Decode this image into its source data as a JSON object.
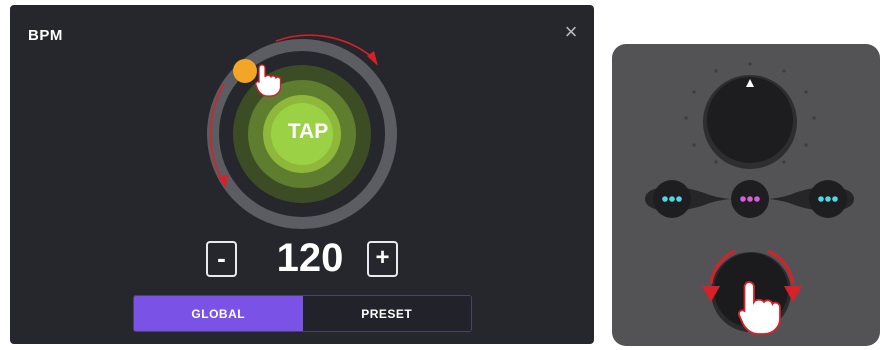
{
  "bpm_dialog": {
    "title": "BPM",
    "close_icon": "×",
    "tap_label": "TAP",
    "bpm_value": "120",
    "decrement_label": "-",
    "increment_label": "+",
    "modes": {
      "global": "GLOBAL",
      "preset": "PRESET"
    },
    "selected_mode": "GLOBAL"
  },
  "icons": [
    "close-icon",
    "hand-pointer-icon",
    "rotate-arrow-icon"
  ],
  "colors": {
    "dialog_bg": "#26272d",
    "accent_purple": "#7a52e6",
    "tap_center": "#9bd144",
    "handle_orange": "#f3a526",
    "arrow_red": "#d72027",
    "led_cyan": "#4fd6e5",
    "led_magenta": "#d45fd8"
  }
}
